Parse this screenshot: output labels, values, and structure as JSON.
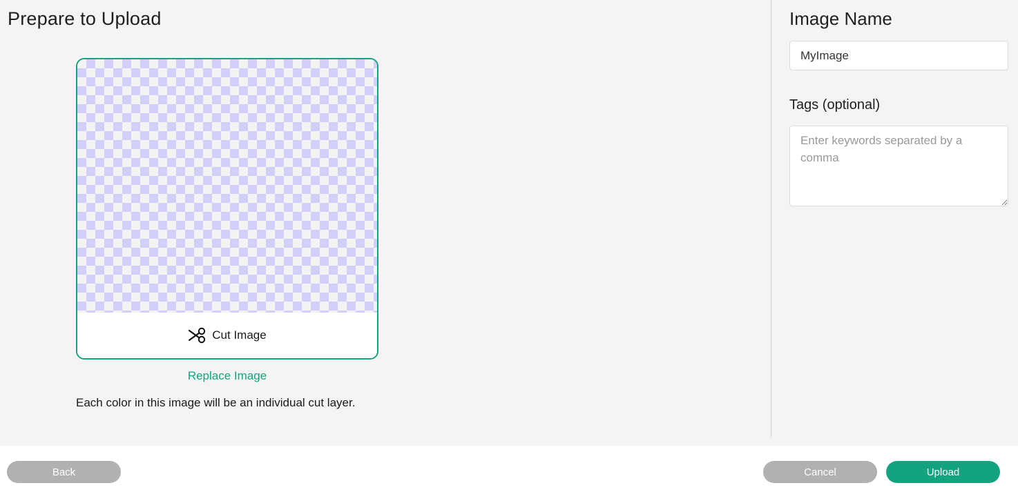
{
  "page": {
    "title": "Prepare to Upload"
  },
  "preview": {
    "cut_label": "Cut Image",
    "cut_icon": "scissors-icon",
    "replace_label": "Replace Image",
    "hint": "Each color in this image will be an individual cut layer."
  },
  "form": {
    "name_heading": "Image Name",
    "name_value": "MyImage",
    "tags_label": "Tags (optional)",
    "tags_placeholder": "Enter keywords separated by a comma"
  },
  "footer": {
    "back_label": "Back",
    "cancel_label": "Cancel",
    "upload_label": "Upload"
  },
  "colors": {
    "accent": "#14a37f",
    "disabled_button": "#b1b1b1",
    "checker_light": "#f3f3f3",
    "checker_dark": "#d2d0fa",
    "background": "#f4f4f4"
  }
}
